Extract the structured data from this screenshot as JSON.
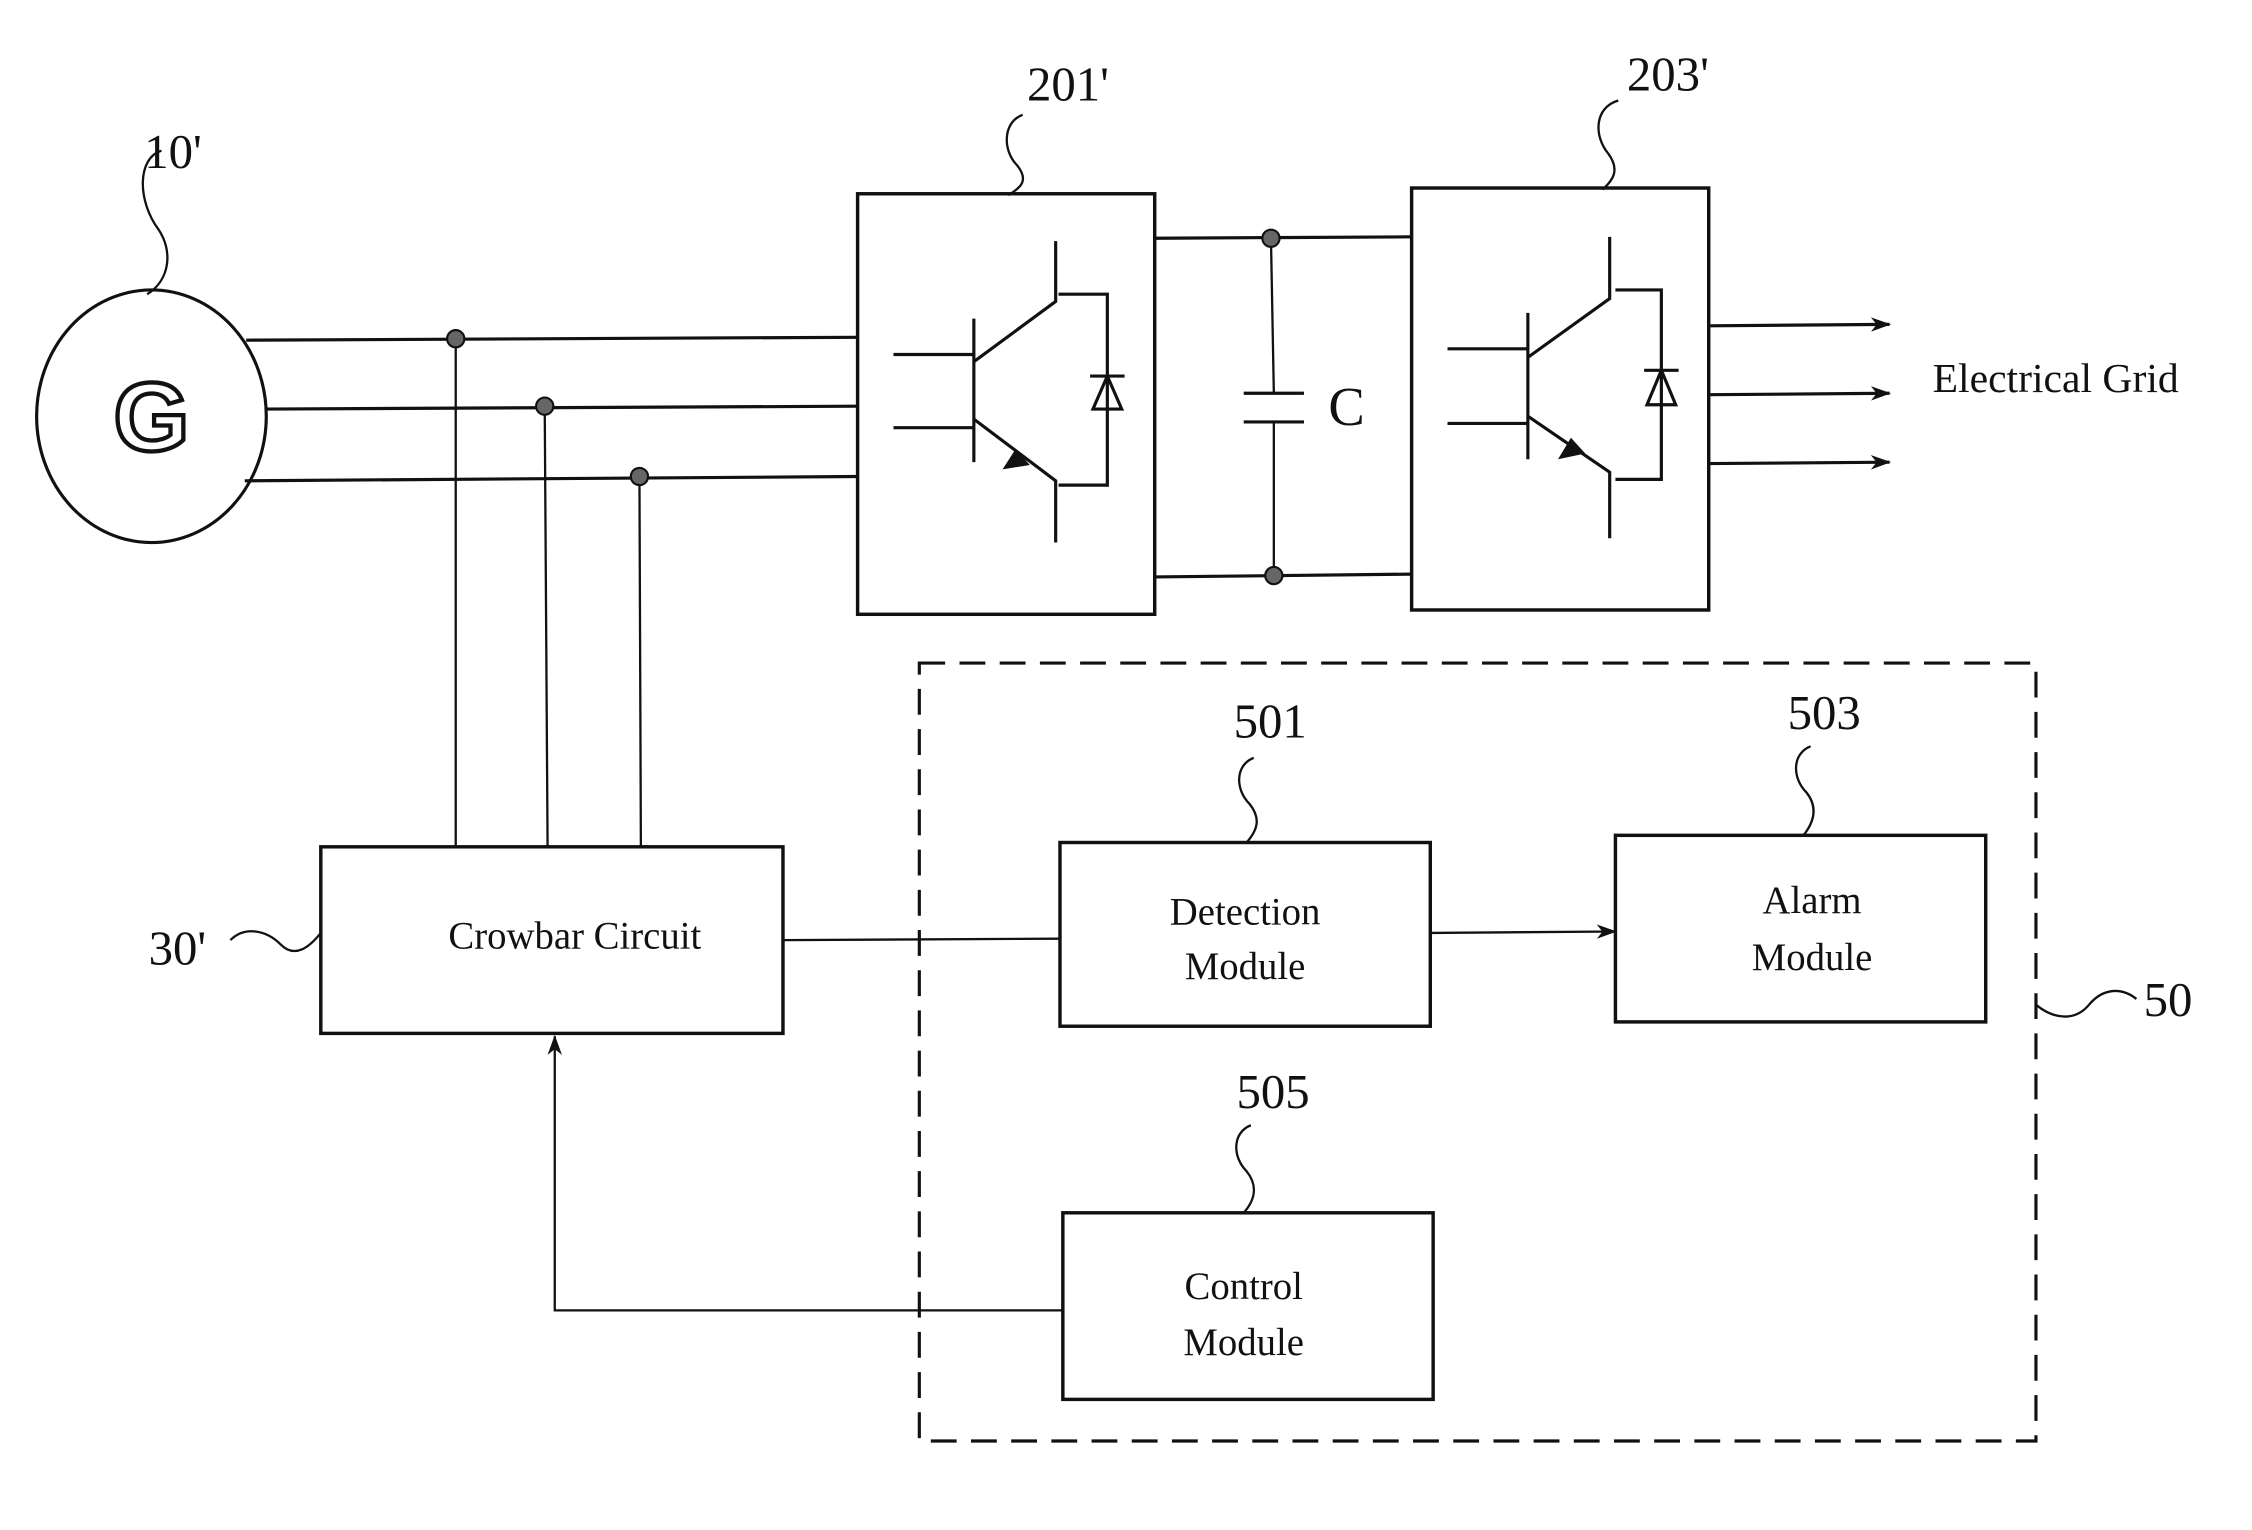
{
  "generator": {
    "ref": "10'",
    "symbol": "G"
  },
  "converter_1": {
    "ref": "201'"
  },
  "converter_2": {
    "ref": "203'"
  },
  "capacitor": {
    "label": "C"
  },
  "grid": {
    "label": "Electrical Grid"
  },
  "crowbar": {
    "ref": "30'",
    "label": "Crowbar Circuit"
  },
  "system": {
    "ref": "50"
  },
  "detection": {
    "ref": "501",
    "line1": "Detection",
    "line2": "Module"
  },
  "alarm": {
    "ref": "503",
    "line1": "Alarm",
    "line2": "Module"
  },
  "control": {
    "ref": "505",
    "line1": "Control",
    "line2": "Module"
  }
}
